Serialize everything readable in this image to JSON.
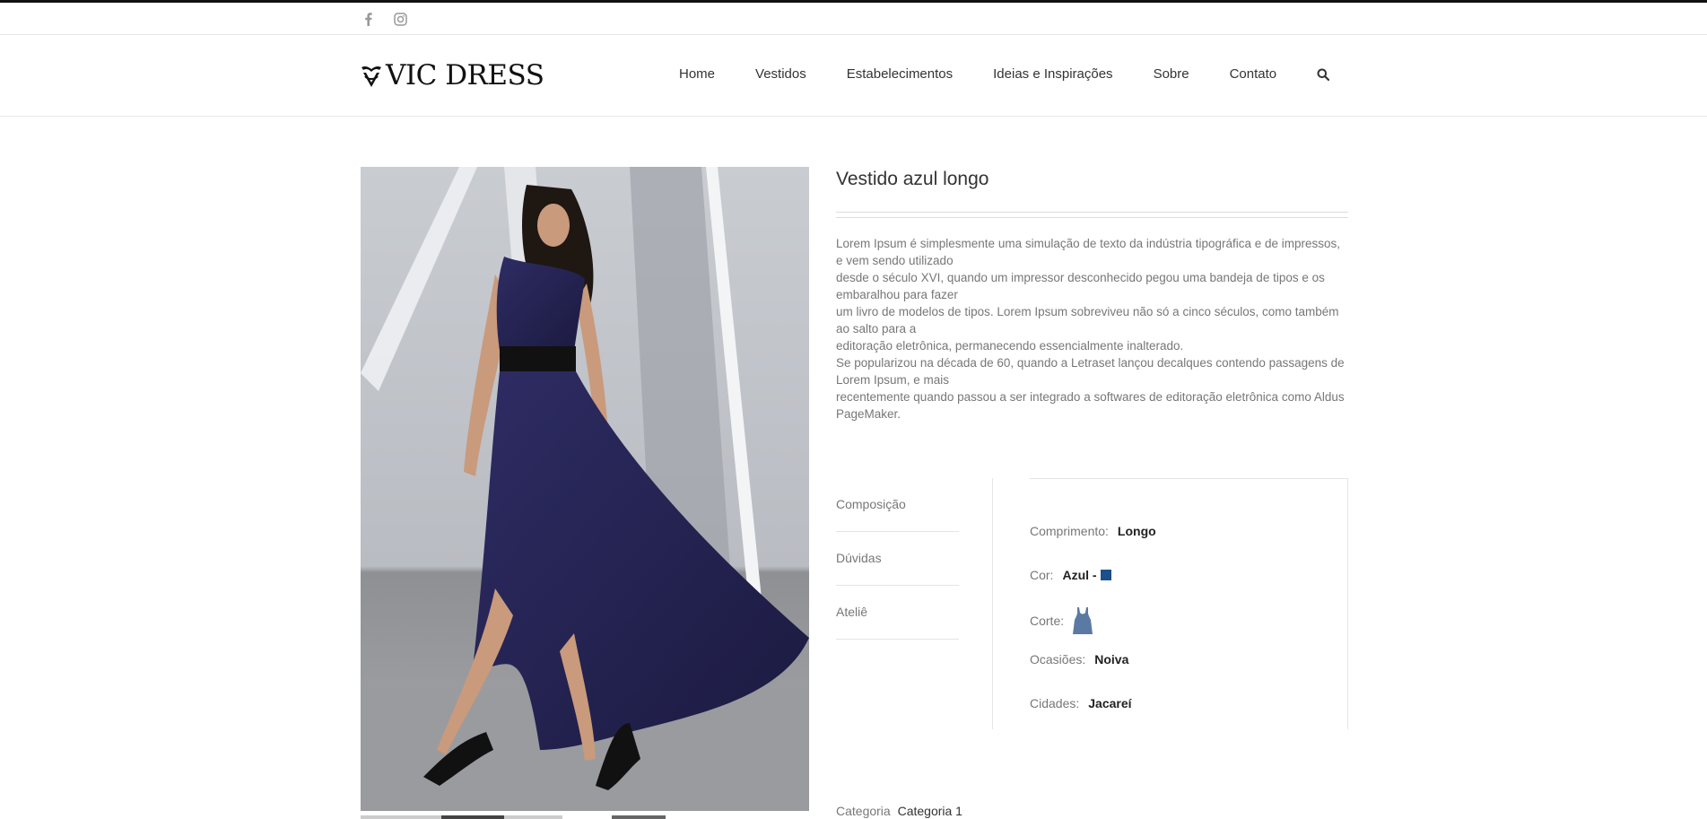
{
  "topbar": {
    "social": [
      {
        "icon": "facebook-icon"
      },
      {
        "icon": "instagram-icon"
      }
    ]
  },
  "header": {
    "logo_text": "VIC DRESS",
    "nav": [
      "Home",
      "Vestidos",
      "Estabelecimentos",
      "Ideias e Inspirações",
      "Sobre",
      "Contato"
    ],
    "search_icon": "search-icon"
  },
  "product": {
    "title": "Vestido azul longo",
    "description": [
      "Lorem Ipsum é simplesmente uma simulação de texto da indústria tipográfica e de impressos, e vem sendo utilizado",
      "desde o século XVI, quando um impressor desconhecido pegou uma bandeja de tipos e os embaralhou para fazer",
      "um livro de modelos de tipos. Lorem Ipsum sobreviveu não só a cinco séculos, como também ao salto para a",
      "editoração eletrônica, permanecendo essencialmente inalterado.",
      "Se popularizou na década de 60, quando a Letraset lançou decalques contendo passagens de Lorem Ipsum, e mais",
      "recentemente quando passou a ser integrado a softwares de editoração eletrônica como Aldus PageMaker."
    ],
    "tabs": [
      "Composição",
      "Dúvidas",
      "Ateliê"
    ],
    "attributes": {
      "comprimento_label": "Comprimento:",
      "comprimento_value": "Longo",
      "cor_label": "Cor:",
      "cor_value": "Azul -",
      "cor_swatch": "#1d4f8a",
      "corte_label": "Corte:",
      "corte_icon": "dress-cut-icon",
      "ocasioes_label": "Ocasiões:",
      "ocasioes_value": "Noiva",
      "cidades_label": "Cidades:",
      "cidades_value": "Jacareí"
    },
    "category_label": "Categoria",
    "category_value": "Categoria 1"
  },
  "colors": {
    "text": "#333333",
    "muted": "#777777",
    "border": "#e4e4e4",
    "dress": "#24234e",
    "swatch": "#1d4f8a"
  }
}
